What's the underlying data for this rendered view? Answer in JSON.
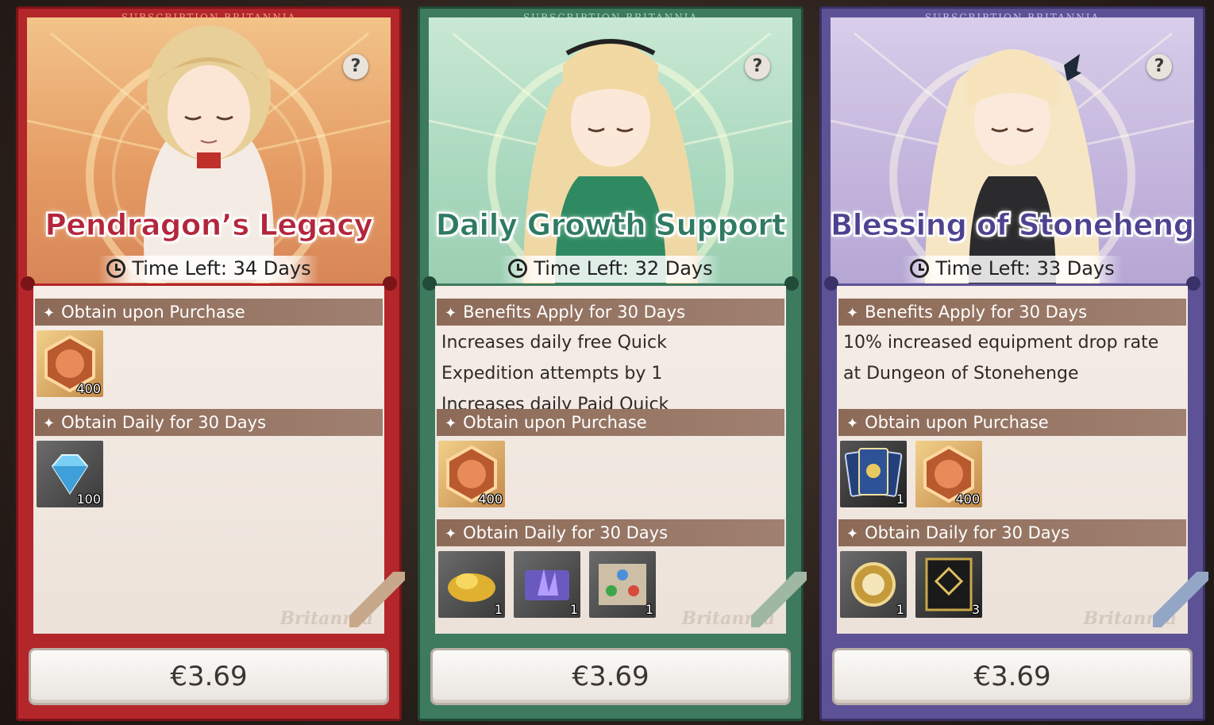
{
  "cards": [
    {
      "id": "pendragon",
      "banner": "SUBSCRIPTION BRITANNIA",
      "title": "Pendragon’s Legacy",
      "time_left": "Time Left: 34 Days",
      "help": "?",
      "sections": [
        {
          "label": "Obtain upon Purchase",
          "items": [
            {
              "icon": "lion-crest-token-icon",
              "count": "400"
            }
          ]
        },
        {
          "label": "Obtain Daily for 30 Days",
          "items": [
            {
              "icon": "blue-diamond-icon",
              "count": "100"
            }
          ]
        }
      ],
      "watermark": "Britannia",
      "price": "€3.69",
      "colors": {
        "main": "#b3262a",
        "dark": "#7a1417",
        "trim": "#e6a08a",
        "title": "#b3263c",
        "hero": "#e8a46a"
      }
    },
    {
      "id": "daily-growth",
      "banner": "SUBSCRIPTION BRITANNIA",
      "title": "Daily Growth Support",
      "time_left": "Time Left: 32 Days",
      "help": "?",
      "benefits_label": "Benefits Apply for 30 Days",
      "benefits_text": [
        "Increases daily free Quick",
        "Expedition attempts by 1",
        "Increases daily Paid Quick"
      ],
      "sections": [
        {
          "label": "Obtain upon Purchase",
          "items": [
            {
              "icon": "lion-crest-token-icon",
              "count": "400"
            }
          ]
        },
        {
          "label": "Obtain Daily for 30 Days",
          "items": [
            {
              "icon": "gold-ore-icon",
              "count": "1"
            },
            {
              "icon": "purple-crystal-icon",
              "count": "1"
            },
            {
              "icon": "element-scroll-icon",
              "count": "1"
            }
          ]
        }
      ],
      "watermark": "Britannia",
      "price": "€3.69",
      "colors": {
        "main": "#3d7a5e",
        "dark": "#214a38",
        "trim": "#a8d4bb",
        "title": "#2f7a62",
        "hero": "#b8dcc4"
      }
    },
    {
      "id": "stonehenge",
      "banner": "SUBSCRIPTION BRITANNIA",
      "title": "Blessing of Stonehenge",
      "time_left": "Time Left: 33 Days",
      "help": "?",
      "benefits_label": "Benefits Apply for 30 Days",
      "benefits_text": [
        "10% increased equipment drop rate",
        "at Dungeon of Stonehenge"
      ],
      "sections": [
        {
          "label": "Obtain upon Purchase",
          "items": [
            {
              "icon": "tarot-cards-icon",
              "count": "1"
            },
            {
              "icon": "lion-crest-token-icon",
              "count": "400"
            }
          ]
        },
        {
          "label": "Obtain Daily for 30 Days",
          "items": [
            {
              "icon": "compass-medal-icon",
              "count": "1"
            },
            {
              "icon": "gold-banner-icon",
              "count": "3"
            }
          ]
        }
      ],
      "watermark": "Britannia",
      "price": "€3.69",
      "colors": {
        "main": "#5d5296",
        "dark": "#3a3168",
        "trim": "#c6bce8",
        "title": "#4e4290",
        "hero": "#c9bde0"
      }
    }
  ]
}
